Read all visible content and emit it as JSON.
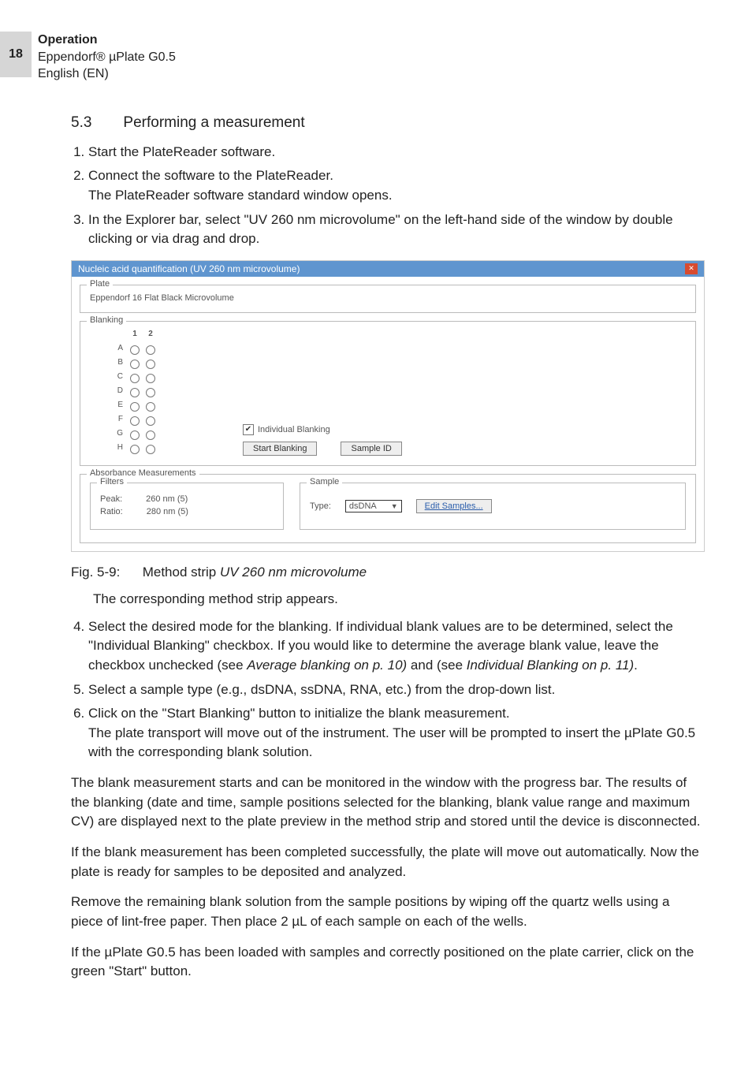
{
  "header": {
    "page_number": "18",
    "section": "Operation",
    "product": "Eppendorf® µPlate G0.5",
    "lang": "English (EN)"
  },
  "section": {
    "num": "5.3",
    "title": "Performing a measurement"
  },
  "steps_a": [
    "Start the PlateReader software.",
    "Connect the software to the PlateReader.\nThe PlateReader software standard window opens.",
    "In the Explorer bar, select \"UV 260 nm microvolume\" on the left-hand side of the window by double clicking or via drag and drop."
  ],
  "window": {
    "title": "Nucleic acid quantification (UV 260 nm microvolume)",
    "close": "✕",
    "plate": {
      "label": "Plate",
      "value": "Eppendorf 16 Flat Black Microvolume"
    },
    "blanking": {
      "label": "Blanking",
      "cols": [
        "1",
        "2"
      ],
      "rows": [
        "A",
        "B",
        "C",
        "D",
        "E",
        "F",
        "G",
        "H"
      ],
      "checkbox": "Individual Blanking",
      "btn_start": "Start Blanking",
      "btn_sample": "Sample ID"
    },
    "abs": {
      "label": "Absorbance Measurements"
    },
    "filters": {
      "label": "Filters",
      "peak_l": "Peak:",
      "peak_v": "260 nm (5)",
      "ratio_l": "Ratio:",
      "ratio_v": "280 nm (5)"
    },
    "sample": {
      "label": "Sample",
      "type_l": "Type:",
      "type_v": "dsDNA",
      "edit": "Edit Samples..."
    }
  },
  "fig_caption": {
    "num": "Fig. 5-9:",
    "text": "Method strip ",
    "italic": "UV 260 nm microvolume"
  },
  "post_fig": "The corresponding method strip appears.",
  "steps_b": [
    {
      "text": "Select the desired mode for the blanking. If individual blank values are to be determined, select the \"Individual Blanking\" checkbox. If you would like to determine the average blank value, leave the checkbox unchecked (see ",
      "i1": "Average blanking on p. 10)",
      "mid": " and (see ",
      "i2": "Individual Blanking on p. 11)",
      "tail": "."
    },
    {
      "text": "Select a sample type (e.g., dsDNA, ssDNA, RNA, etc.) from the drop-down list."
    },
    {
      "text": "Click on the \"Start Blanking\" button to initialize the blank measurement.\nThe plate transport will move out of the instrument. The user will be prompted to insert the µPlate G0.5 with the corresponding blank solution."
    }
  ],
  "paras": [
    "The blank measurement starts and can be monitored in the window with the progress bar. The results of the blanking (date and time, sample positions selected for the blanking, blank value range and maximum CV) are displayed next to the plate preview in the method strip and stored until the device is disconnected.",
    "If the blank measurement has been completed successfully, the plate will move out automatically. Now the plate is ready for samples to be deposited and analyzed.",
    "Remove the remaining blank solution from the sample positions by wiping off the quartz wells using a piece of lint-free paper. Then place 2 µL of each sample on each of the wells.",
    "If the µPlate G0.5 has been loaded with samples and correctly positioned on the plate carrier, click on the green \"Start\" button."
  ]
}
